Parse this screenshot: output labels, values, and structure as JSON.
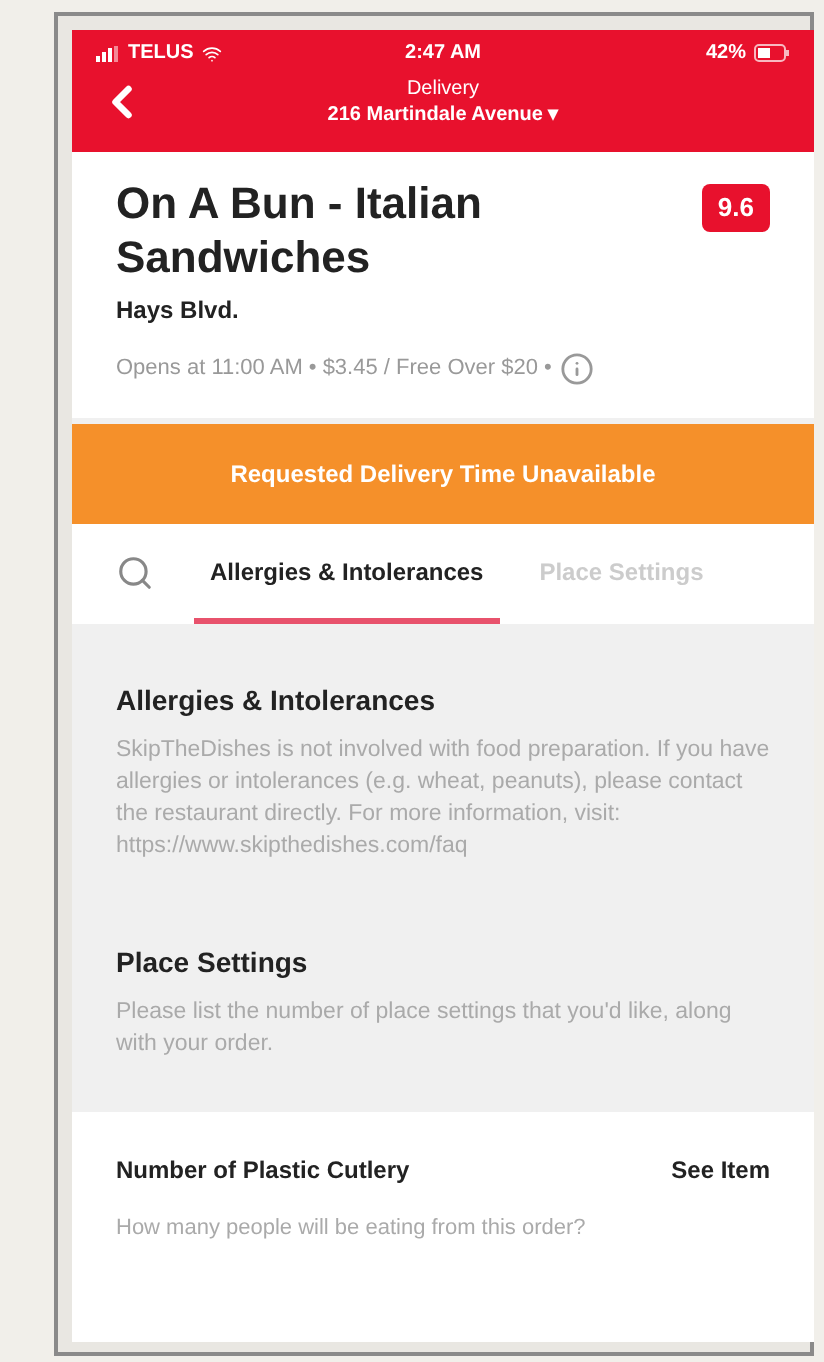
{
  "status_bar": {
    "carrier": "TELUS",
    "time": "2:47 AM",
    "battery": "42%"
  },
  "header": {
    "mode": "Delivery",
    "address": "216 Martindale Avenue ▾"
  },
  "restaurant": {
    "name": "On A Bun - Italian Sandwiches",
    "location": "Hays Blvd.",
    "rating": "9.6",
    "info": "Opens at 11:00 AM • $3.45 / Free Over $20 •"
  },
  "banner": "Requested Delivery Time Unavailable",
  "tabs": [
    {
      "label": "Allergies & Intolerances",
      "selected": true
    },
    {
      "label": "Place Settings",
      "selected": false
    }
  ],
  "sections": [
    {
      "title": "Allergies & Intolerances",
      "text": "SkipTheDishes is not involved with food preparation. If you have allergies or intolerances (e.g. wheat, peanuts), please contact the restaurant directly. For more information, visit: https://www.skipthedishes.com/faq"
    },
    {
      "title": "Place Settings",
      "text": "Please list the number of place settings that you'd like, along with your order."
    }
  ],
  "option": {
    "title": "Number of Plastic Cutlery",
    "action": "See Item",
    "hint": "How many people will be eating from this order?"
  }
}
